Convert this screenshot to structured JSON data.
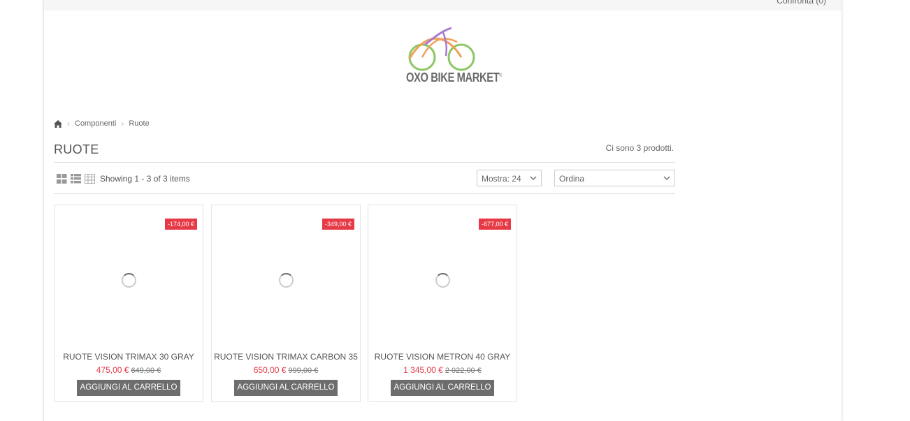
{
  "header": {
    "compare_label": "Confronta (0)",
    "logo_text": "OXO BIKE MARKET",
    "logo_mark": "®"
  },
  "breadcrumb": {
    "home_icon": "home-icon",
    "items": [
      "Componenti",
      "Ruote"
    ]
  },
  "category": {
    "title": "RUOTE",
    "count_text": "Ci sono 3 prodotti."
  },
  "toolbar": {
    "view_icons": [
      "grid-view-icon",
      "list-view-icon",
      "table-view-icon"
    ],
    "showing_text": "Showing 1 - 3 of 3 items",
    "show_select": "Mostra: 24",
    "order_select": "Ordina"
  },
  "colors": {
    "accent": "#e63a46",
    "button": "#6d6d6d"
  },
  "products": [
    {
      "name": "RUOTE VISION TRIMAX 30 GRAY",
      "price": "475,00 €",
      "old_price": "649,00 €",
      "discount": "-174,00 €",
      "button": "AGGIUNGI AL CARRELLO"
    },
    {
      "name": "RUOTE VISION TRIMAX CARBON 35",
      "price": "650,00 €",
      "old_price": "999,00 €",
      "discount": "-349,00 €",
      "button": "AGGIUNGI AL CARRELLO"
    },
    {
      "name": "RUOTE VISION METRON 40 GRAY",
      "price": "1 345,00 €",
      "old_price": "2 022,00 €",
      "discount": "-677,00 €",
      "button": "AGGIUNGI AL CARRELLO"
    }
  ]
}
